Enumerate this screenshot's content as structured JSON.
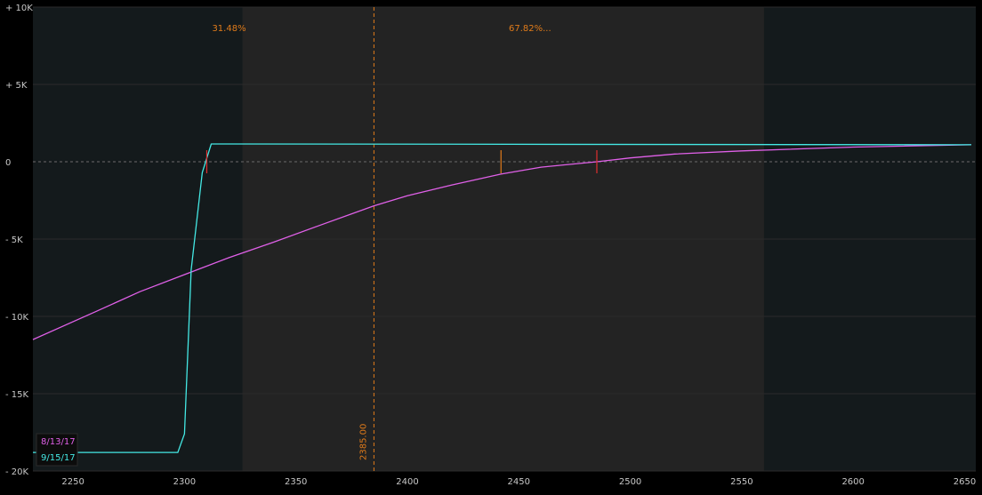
{
  "chart_data": {
    "type": "line",
    "xlim": [
      2232,
      2655
    ],
    "ylim": [
      -20000,
      10000
    ],
    "x_ticks": [
      {
        "value": 2250,
        "label": "2250"
      },
      {
        "value": 2300,
        "label": "2300"
      },
      {
        "value": 2350,
        "label": "2350"
      },
      {
        "value": 2400,
        "label": "2400"
      },
      {
        "value": 2450,
        "label": "2450"
      },
      {
        "value": 2500,
        "label": "2500"
      },
      {
        "value": 2550,
        "label": "2550"
      },
      {
        "value": 2600,
        "label": "2600"
      },
      {
        "value": 2650,
        "label": "2650"
      }
    ],
    "y_ticks": [
      {
        "value": 10000,
        "label": "+ 10K"
      },
      {
        "value": 5000,
        "label": "+ 5K"
      },
      {
        "value": 0,
        "label": "0"
      },
      {
        "value": -5000,
        "label": "- 5K"
      },
      {
        "value": -10000,
        "label": "- 10K"
      },
      {
        "value": -15000,
        "label": "- 15K"
      },
      {
        "value": -20000,
        "label": "- 20K"
      }
    ],
    "zero_line": true,
    "probability_range": [
      2326,
      2560
    ],
    "probability_labels": [
      {
        "x": 2320,
        "text": "31.48%",
        "color": "#e07b1a"
      },
      {
        "x": 2455,
        "text": "67.82%...",
        "color": "#e07b1a"
      }
    ],
    "current_price": {
      "value": 2385,
      "label": "2385.00",
      "color": "#e07b1a"
    },
    "markers": [
      {
        "x": 2310,
        "color": "#e03030"
      },
      {
        "x": 2442,
        "color": "#e07b1a"
      },
      {
        "x": 2485,
        "color": "#e03030"
      }
    ],
    "series": [
      {
        "name": "8/13/17",
        "color": "#e060e8",
        "x": [
          2232,
          2260,
          2280,
          2300,
          2320,
          2340,
          2360,
          2385,
          2400,
          2420,
          2442,
          2460,
          2485,
          2500,
          2520,
          2550,
          2600,
          2653
        ],
        "y": [
          -11500,
          -9700,
          -8400,
          -7300,
          -6200,
          -5200,
          -4150,
          -2850,
          -2200,
          -1500,
          -800,
          -350,
          0,
          250,
          500,
          700,
          950,
          1100
        ]
      },
      {
        "name": "9/15/17",
        "color": "#44e8e4",
        "x": [
          2232,
          2297,
          2300,
          2303,
          2308,
          2312,
          2653
        ],
        "y": [
          -18800,
          -18800,
          -17600,
          -7000,
          -700,
          1150,
          1100
        ]
      }
    ]
  },
  "legend": [
    {
      "label": "8/13/17",
      "color": "#e060e8"
    },
    {
      "label": "9/15/17",
      "color": "#44e8e4"
    }
  ],
  "colors": {
    "background": "#000000",
    "plot_outer": "#141a1c",
    "plot_inner": "#232323",
    "axis_text": "#c8c8c8",
    "grid": "#2b2b2b",
    "zero_line": "#6b6b6b"
  }
}
